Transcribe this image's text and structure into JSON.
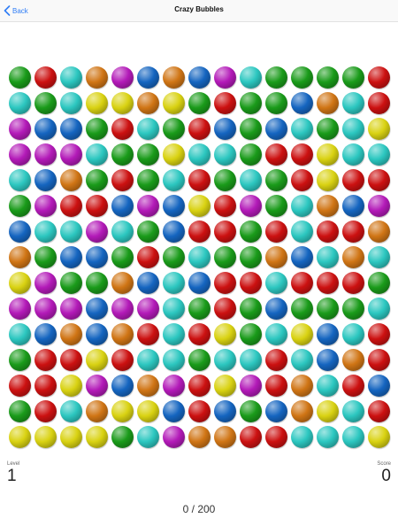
{
  "nav": {
    "back_label": "Back",
    "title": "Crazy Bubbles"
  },
  "stats": {
    "level_label": "Level",
    "level_value": "1",
    "score_label": "Score",
    "score_value": "0"
  },
  "progress": {
    "current": 0,
    "total": 200,
    "text": "0 / 200"
  },
  "colors": {
    "G": "#1a9b1a",
    "R": "#cc1111",
    "C": "#2cc7c0",
    "O": "#d07515",
    "M": "#b31ab8",
    "B": "#1565c0",
    "Y": "#d9d212"
  },
  "grid": [
    "GRCOMBOBMCGGGGR",
    "CGCYYOYGRGGBOCR",
    "MBBGRCGRBGBCGCY",
    "MMMCGGYCCGRRYCC",
    "CBOGRGCRGCGRYRR",
    "GMRRBMBYRMGCOBM",
    "BCCMCGBRRGRCRRO",
    "OGBBGRGCGGOBCOC",
    "YMGGOBCBRRCRRRG",
    "MMMBMMCGRGBGGGC",
    "CBOBORCRYGCYBCR",
    "GRRYRCCGCCRCBOR",
    "RRYMBOMRYMROCRB",
    "GRCOYYBRBGBOYCR",
    "YYYYGCMOORRCCCY"
  ]
}
